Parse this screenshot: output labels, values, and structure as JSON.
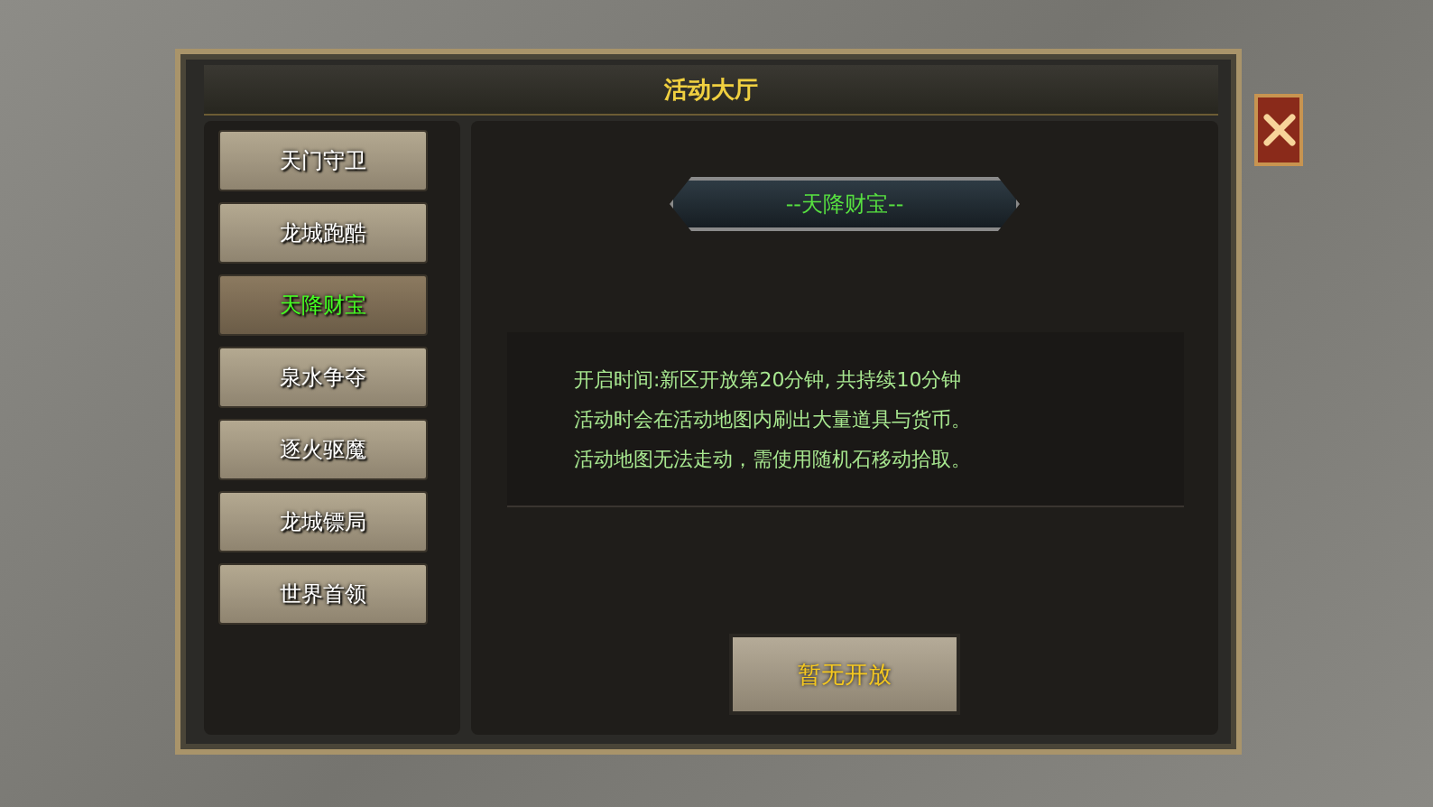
{
  "window": {
    "title": "活动大厅"
  },
  "sidebar": {
    "items": [
      {
        "label": "天门守卫",
        "selected": false
      },
      {
        "label": "龙城跑酷",
        "selected": false
      },
      {
        "label": "天降财宝",
        "selected": true
      },
      {
        "label": "泉水争夺",
        "selected": false
      },
      {
        "label": "逐火驱魔",
        "selected": false
      },
      {
        "label": "龙城镖局",
        "selected": false
      },
      {
        "label": "世界首领",
        "selected": false
      }
    ]
  },
  "detail": {
    "heading": "--天降财宝--",
    "lines": [
      "开启时间:新区开放第20分钟, 共持续10分钟",
      "活动时会在活动地图内刷出大量道具与货币。",
      "活动地图无法走动，需使用随机石移动拾取。"
    ],
    "action": "暂无开放"
  }
}
